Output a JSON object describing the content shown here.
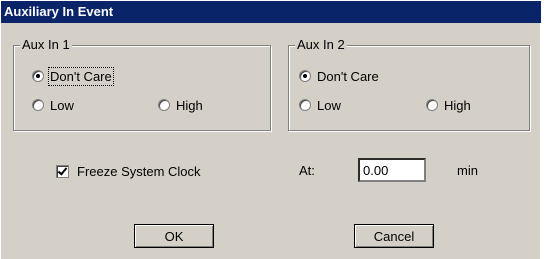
{
  "dialog": {
    "title": "Auxiliary In Event"
  },
  "aux_in_1": {
    "legend": "Aux In 1",
    "options": {
      "dont_care": "Don't Care",
      "low": "Low",
      "high": "High"
    },
    "selected": "Don't Care"
  },
  "aux_in_2": {
    "legend": "Aux In 2",
    "options": {
      "dont_care": "Don't Care",
      "low": "Low",
      "high": "High"
    },
    "selected": "Don't Care"
  },
  "freeze": {
    "label": "Freeze System Clock",
    "checked": true
  },
  "at": {
    "label": "At:",
    "value": "0.00",
    "unit": "min"
  },
  "buttons": {
    "ok": "OK",
    "cancel": "Cancel"
  }
}
